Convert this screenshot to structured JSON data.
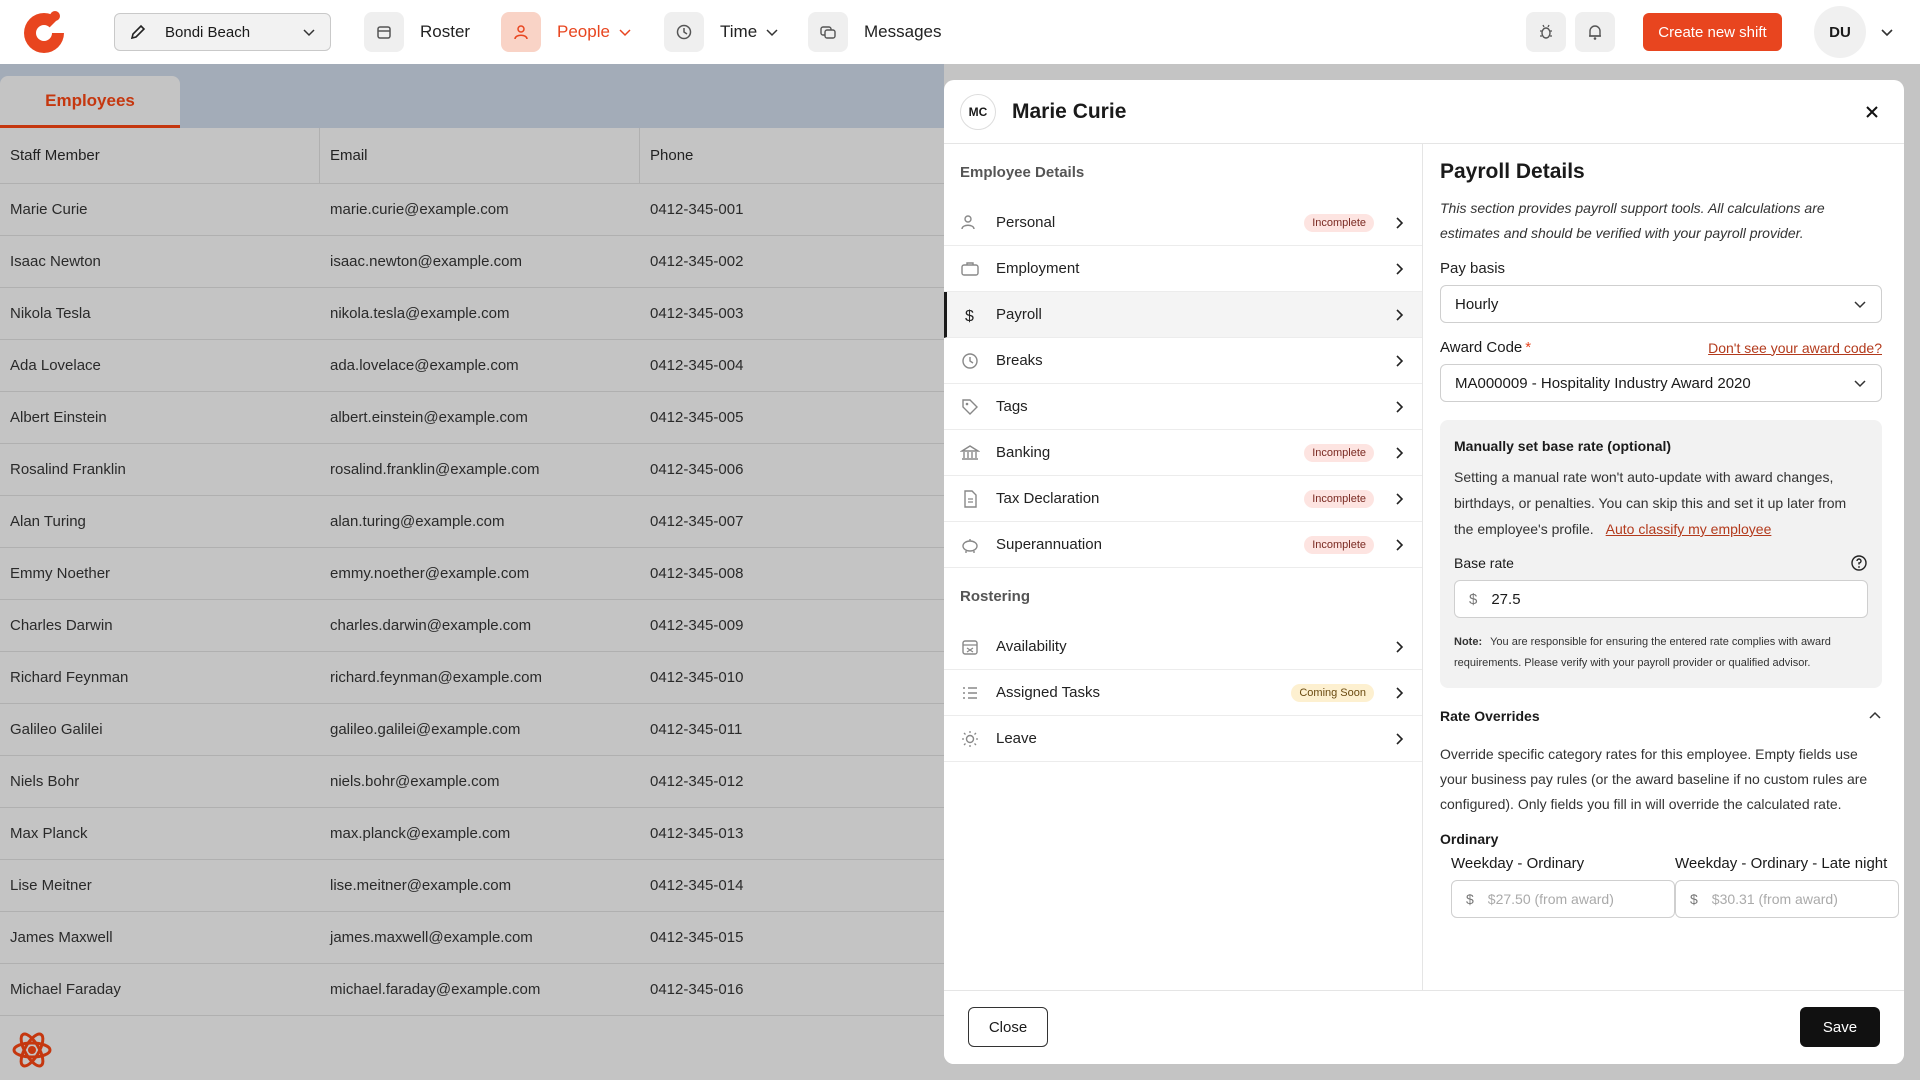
{
  "topbar": {
    "location": "Bondi Beach",
    "nav": [
      {
        "label": "Roster"
      },
      {
        "label": "People"
      },
      {
        "label": "Time"
      },
      {
        "label": "Messages"
      }
    ],
    "create_label": "Create new shift",
    "user_initials": "DU",
    "accent": "#e8451f"
  },
  "employees": {
    "tab_label": "Employees",
    "columns": [
      "Staff Member",
      "Email",
      "Phone"
    ],
    "rows": [
      [
        "Marie Curie",
        "marie.curie@example.com",
        "0412-345-001"
      ],
      [
        "Isaac Newton",
        "isaac.newton@example.com",
        "0412-345-002"
      ],
      [
        "Nikola Tesla",
        "nikola.tesla@example.com",
        "0412-345-003"
      ],
      [
        "Ada Lovelace",
        "ada.lovelace@example.com",
        "0412-345-004"
      ],
      [
        "Albert Einstein",
        "albert.einstein@example.com",
        "0412-345-005"
      ],
      [
        "Rosalind Franklin",
        "rosalind.franklin@example.com",
        "0412-345-006"
      ],
      [
        "Alan Turing",
        "alan.turing@example.com",
        "0412-345-007"
      ],
      [
        "Emmy Noether",
        "emmy.noether@example.com",
        "0412-345-008"
      ],
      [
        "Charles Darwin",
        "charles.darwin@example.com",
        "0412-345-009"
      ],
      [
        "Richard Feynman",
        "richard.feynman@example.com",
        "0412-345-010"
      ],
      [
        "Galileo Galilei",
        "galileo.galilei@example.com",
        "0412-345-011"
      ],
      [
        "Niels Bohr",
        "niels.bohr@example.com",
        "0412-345-012"
      ],
      [
        "Max Planck",
        "max.planck@example.com",
        "0412-345-013"
      ],
      [
        "Lise Meitner",
        "lise.meitner@example.com",
        "0412-345-014"
      ],
      [
        "James Maxwell",
        "james.maxwell@example.com",
        "0412-345-015"
      ],
      [
        "Michael Faraday",
        "michael.faraday@example.com",
        "0412-345-016"
      ]
    ]
  },
  "dialog": {
    "initials": "MC",
    "title": "Marie Curie",
    "employee_details_heading": "Employee Details",
    "employee_details": [
      {
        "label": "Personal",
        "badge": "Incomplete",
        "icon": "person-icon"
      },
      {
        "label": "Employment",
        "badge": "",
        "icon": "briefcase-icon"
      },
      {
        "label": "Payroll",
        "badge": "",
        "icon": "dollar-icon"
      },
      {
        "label": "Breaks",
        "badge": "",
        "icon": "clock-icon"
      },
      {
        "label": "Tags",
        "badge": "",
        "icon": "tag-icon"
      },
      {
        "label": "Banking",
        "badge": "Incomplete",
        "icon": "bank-icon"
      },
      {
        "label": "Tax Declaration",
        "badge": "Incomplete",
        "icon": "document-icon"
      },
      {
        "label": "Superannuation",
        "badge": "Incomplete",
        "icon": "piggy-bank-icon"
      }
    ],
    "rostering_heading": "Rostering",
    "rostering": [
      {
        "label": "Availability",
        "badge": "",
        "icon": "calendar-icon"
      },
      {
        "label": "Assigned Tasks",
        "badge": "Coming Soon",
        "icon": "checklist-icon"
      },
      {
        "label": "Leave",
        "badge": "",
        "icon": "sun-icon"
      }
    ],
    "payroll": {
      "title": "Payroll Details",
      "description": "This section provides payroll support tools. All calculations are estimates and should be verified with your payroll provider.",
      "pay_basis_label": "Pay basis",
      "pay_basis_value": "Hourly",
      "award_code_label": "Award Code",
      "award_required_mark": "*",
      "award_link": "Don't see your award code?",
      "award_code_value": "MA000009 - Hospitality Industry Award 2020",
      "manual_title": "Manually set base rate (optional)",
      "manual_text": "Setting a manual rate won't auto-update with award changes, birthdays, or penalties. You can skip this and set it up later from the employee's profile.",
      "auto_classify_link": "Auto classify my employee",
      "base_rate_label": "Base rate",
      "currency_symbol": "$",
      "base_rate_value": "27.5",
      "note_label": "Note:",
      "note_text": "You are responsible for ensuring the entered rate complies with award requirements. Please verify with your payroll provider or qualified advisor.",
      "rate_overrides_title": "Rate Overrides",
      "rate_overrides_text": "Override specific category rates for this employee. Empty fields use your business pay rules (or the award baseline if no custom rules are configured). Only fields you fill in will override the calculated rate.",
      "ordinary_heading": "Ordinary",
      "rates": [
        {
          "label": "Weekday - Ordinary",
          "placeholder": "$27.50 (from award)"
        },
        {
          "label": "Weekday - Ordinary - Late night",
          "placeholder": "$30.31 (from award)"
        }
      ]
    },
    "close_label": "Close",
    "save_label": "Save"
  }
}
